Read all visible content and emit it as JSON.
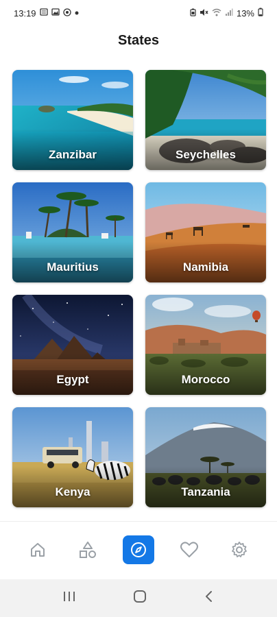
{
  "status_bar": {
    "time": "13:19",
    "battery": "13%",
    "left_icons": [
      "notification-icon",
      "gallery-icon",
      "vpn-icon",
      "dot-icon"
    ],
    "right_icons": [
      "battery-saver-icon",
      "mute-icon",
      "wifi-icon",
      "signal-icon",
      "battery-icon"
    ]
  },
  "header": {
    "title": "States"
  },
  "cards": [
    {
      "name": "Zanzibar"
    },
    {
      "name": "Seychelles"
    },
    {
      "name": "Mauritius"
    },
    {
      "name": "Namibia"
    },
    {
      "name": "Egypt"
    },
    {
      "name": "Morocco"
    },
    {
      "name": "Kenya"
    },
    {
      "name": "Tanzania"
    }
  ],
  "bottom_nav": {
    "items": [
      "home-icon",
      "categories-icon",
      "explore-icon",
      "favorites-icon",
      "settings-icon"
    ],
    "active": "explore-icon",
    "accent": "#1478e6"
  },
  "system_nav": [
    "recents-icon",
    "home-circle-icon",
    "back-icon"
  ]
}
